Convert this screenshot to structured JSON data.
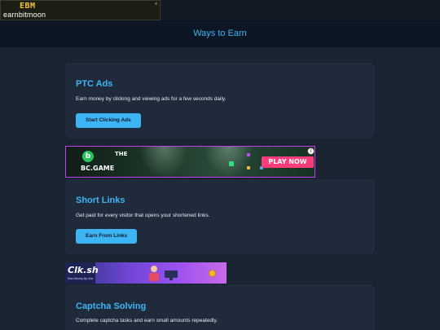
{
  "top_banner": {
    "logo_mark": "EBM",
    "logo_text": "earnbitmoon",
    "close_glyph": "×"
  },
  "header": {
    "title": "Ways to Earn"
  },
  "cards": [
    {
      "title": "PTC Ads",
      "description": "Earn money by clicking and viewing ads for a few seconds daily.",
      "button_label": "Start Clicking Ads"
    },
    {
      "title": "Short Links",
      "description": "Get paid for every visitor that opens your shortened links.",
      "button_label": "Earn From Links"
    },
    {
      "title": "Captcha Solving",
      "description": "Complete captcha tasks and earn small amounts repeatedly."
    }
  ],
  "ad_banner_1": {
    "brand_mark": "b",
    "brand": "BC.GAME",
    "headline": "THE",
    "cta": "PLAY NOW",
    "badge_glyph": "i",
    "colors": {
      "border": "#c43cf0",
      "cta_bg": "#ff3c7a",
      "logo_bg": "#25c45e"
    }
  },
  "ad_banner_2": {
    "brand": "Clk.sh",
    "tagline": "Earn Money By Urls",
    "icons": [
      "person-icon",
      "monitor-icon",
      "coin-icon"
    ]
  },
  "colors": {
    "background": "#1a2332",
    "header_bg": "#0c1624",
    "card_bg": "#1f2a3a",
    "accent": "#3db5f5"
  }
}
